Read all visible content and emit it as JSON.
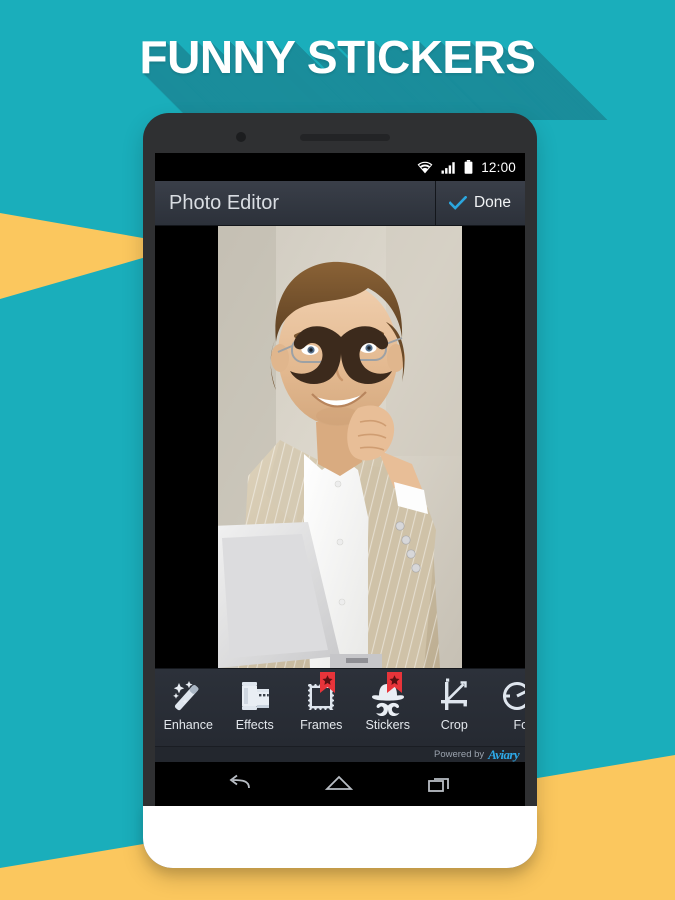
{
  "page": {
    "title": "FUNNY STICKERS",
    "colors": {
      "background_teal": "#1AAEBB",
      "title_shadow_teal": "#1A8D9B",
      "accent_yellow": "#FBC75E",
      "title_white": "#FFFFFF",
      "badge_red": "#E8343A",
      "done_check_blue": "#2BA6DE",
      "powered_logo_blue": "#2DA9E8"
    }
  },
  "phone": {
    "hardware": {
      "camera_icon": "camera-dot",
      "speaker_icon": "earpiece-speaker"
    },
    "status_bar": {
      "wifi_icon": "wifi-icon",
      "signal_icon": "cellular-signal-icon",
      "battery_icon": "battery-icon",
      "time": "12:00"
    },
    "app_bar": {
      "title": "Photo Editor",
      "done_check_icon": "check-icon",
      "done_label": "Done"
    },
    "canvas": {
      "photo_alt": "man-with-glasses-photo",
      "sticker_alt": "mustache-sticker"
    },
    "toolbar": {
      "items": [
        {
          "label": "Enhance",
          "icon": "magic-wand-icon",
          "badge": false
        },
        {
          "label": "Effects",
          "icon": "film-roll-icon",
          "badge": false
        },
        {
          "label": "Frames",
          "icon": "picture-frame-icon",
          "badge": true
        },
        {
          "label": "Stickers",
          "icon": "hat-mustache-icon",
          "badge": true
        },
        {
          "label": "Crop",
          "icon": "crop-icon",
          "badge": false
        },
        {
          "label": "Fo",
          "icon": "focus-icon",
          "badge": false
        }
      ],
      "badge_icon": "star-ribbon-icon"
    },
    "powered_by": {
      "text": "Powered by",
      "brand": "Aviary"
    },
    "nav_bar": {
      "back_icon": "back-arrow-icon",
      "home_icon": "home-icon",
      "recents_icon": "recents-icon"
    }
  }
}
